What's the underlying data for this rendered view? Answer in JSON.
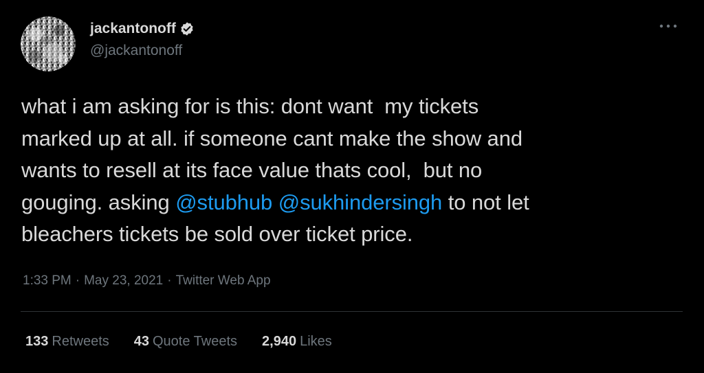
{
  "user": {
    "display_name": "jackantonoff",
    "handle": "@jackantonoff",
    "verified": true,
    "avatar_icon": "avatar-photo"
  },
  "more_icon": "more-dots-icon",
  "tweet": {
    "line1": "what i am asking for is this: dont want  my tickets",
    "line2": "marked up at all. if someone cant make the show and",
    "line3": "wants to resell at its face value thats cool,  but no",
    "line4_before": "gouging. asking ",
    "mention1": "@stubhub",
    "line4_between": " ",
    "mention2": "@sukhindersingh",
    "line4_after": " to not let",
    "line5": "bleachers tickets be sold over ticket price."
  },
  "meta": {
    "time": "1:33 PM",
    "date": "May 23, 2021",
    "source": "Twitter Web App",
    "separator": "·"
  },
  "stats": {
    "retweets_count": "133",
    "retweets_label": "Retweets",
    "quotes_count": "43",
    "quotes_label": "Quote Tweets",
    "likes_count": "2,940",
    "likes_label": "Likes"
  },
  "colors": {
    "background": "#000000",
    "text": "#d9d9d9",
    "muted": "#6e767d",
    "mention": "#1d9bf0",
    "divider": "#2f3336"
  }
}
